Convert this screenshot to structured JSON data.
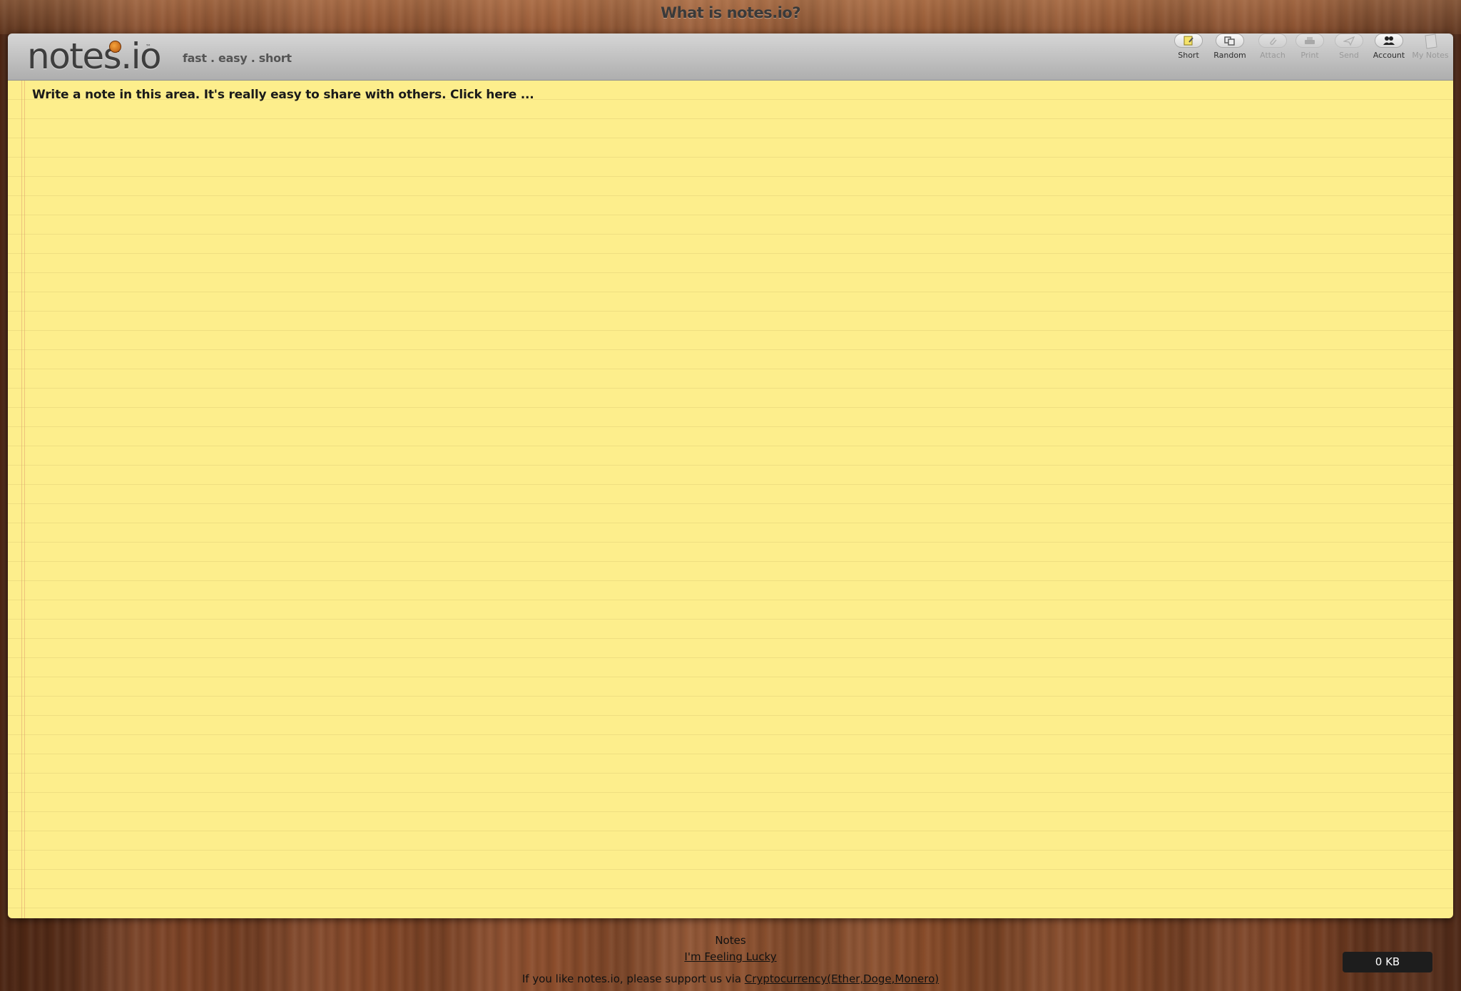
{
  "header": {
    "site_title": "What is notes.io?"
  },
  "toolbar": {
    "logo_text": "notes.io",
    "logo_tm": "™",
    "tagline": "fast . easy . short",
    "buttons": [
      {
        "label": "Short",
        "icon": "note-pencil-icon",
        "enabled": true
      },
      {
        "label": "Random",
        "icon": "copy-pages-icon",
        "enabled": true
      },
      {
        "label": "Attach",
        "icon": "paperclip-icon",
        "enabled": false
      },
      {
        "label": "Print",
        "icon": "printer-icon",
        "enabled": false
      },
      {
        "label": "Send",
        "icon": "paper-plane-icon",
        "enabled": false
      },
      {
        "label": "Account",
        "icon": "users-icon",
        "enabled": true
      },
      {
        "label": "My Notes",
        "icon": "notepad-icon",
        "enabled": false
      }
    ]
  },
  "note": {
    "placeholder_text": "Write a note in this area.  It's really easy to share with others. Click here ..."
  },
  "footer": {
    "title": "Notes",
    "lucky_link": "I'm Feeling Lucky",
    "support_prefix": "If you like notes.io, please support us via ",
    "support_link": "Cryptocurrency(Ether,Doge,Monero)",
    "size_badge": "0 KB"
  },
  "colors": {
    "note_paper": "#fdee8c",
    "wood": "#7a4124",
    "toolbar": "#c4c4c4",
    "badge": "#1d1d1d"
  }
}
